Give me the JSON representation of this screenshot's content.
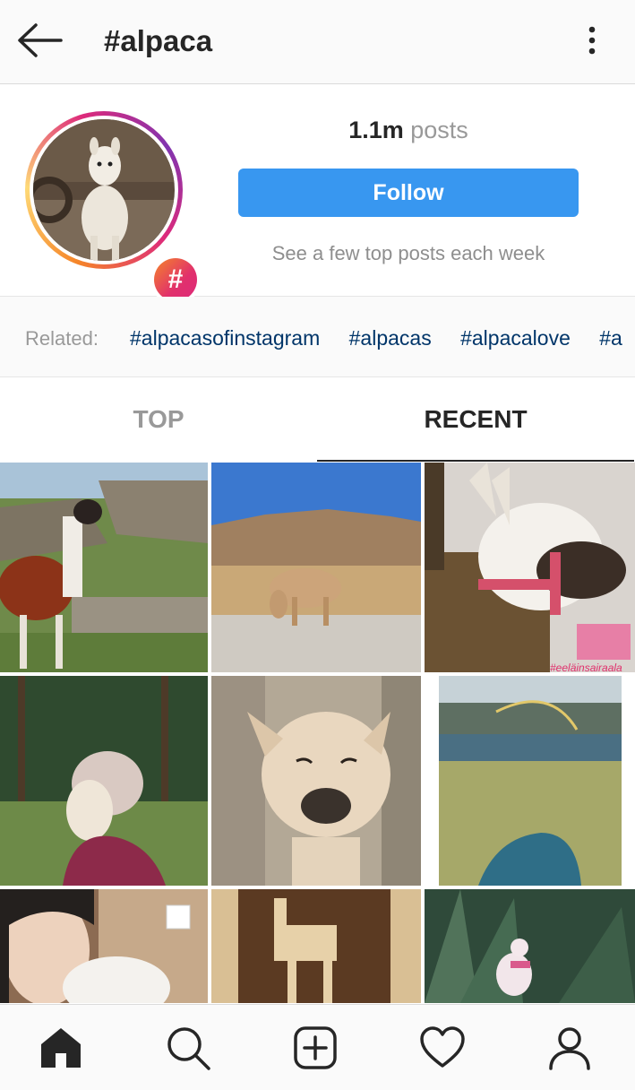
{
  "header": {
    "title": "#alpaca",
    "back_icon": "arrow-left-icon",
    "more_icon": "more-vertical-icon"
  },
  "profile": {
    "posts_count": "1.1m",
    "posts_label": "posts",
    "follow_label": "Follow",
    "hint": "See a few top posts each week",
    "badge_symbol": "#"
  },
  "related": {
    "label": "Related:",
    "tags": [
      "#alpacasofinstagram",
      "#alpacas",
      "#alpacalove",
      "#a"
    ]
  },
  "tabs": {
    "top": "TOP",
    "recent": "RECENT",
    "active": "RECENT"
  },
  "grid": {
    "overlay_text": "#eeläinsairaala"
  },
  "nav": {
    "items": [
      "home-icon",
      "search-icon",
      "add-post-icon",
      "heart-icon",
      "profile-icon"
    ]
  },
  "colors": {
    "accent": "#3897f0",
    "link": "#003569",
    "muted": "#999999"
  }
}
